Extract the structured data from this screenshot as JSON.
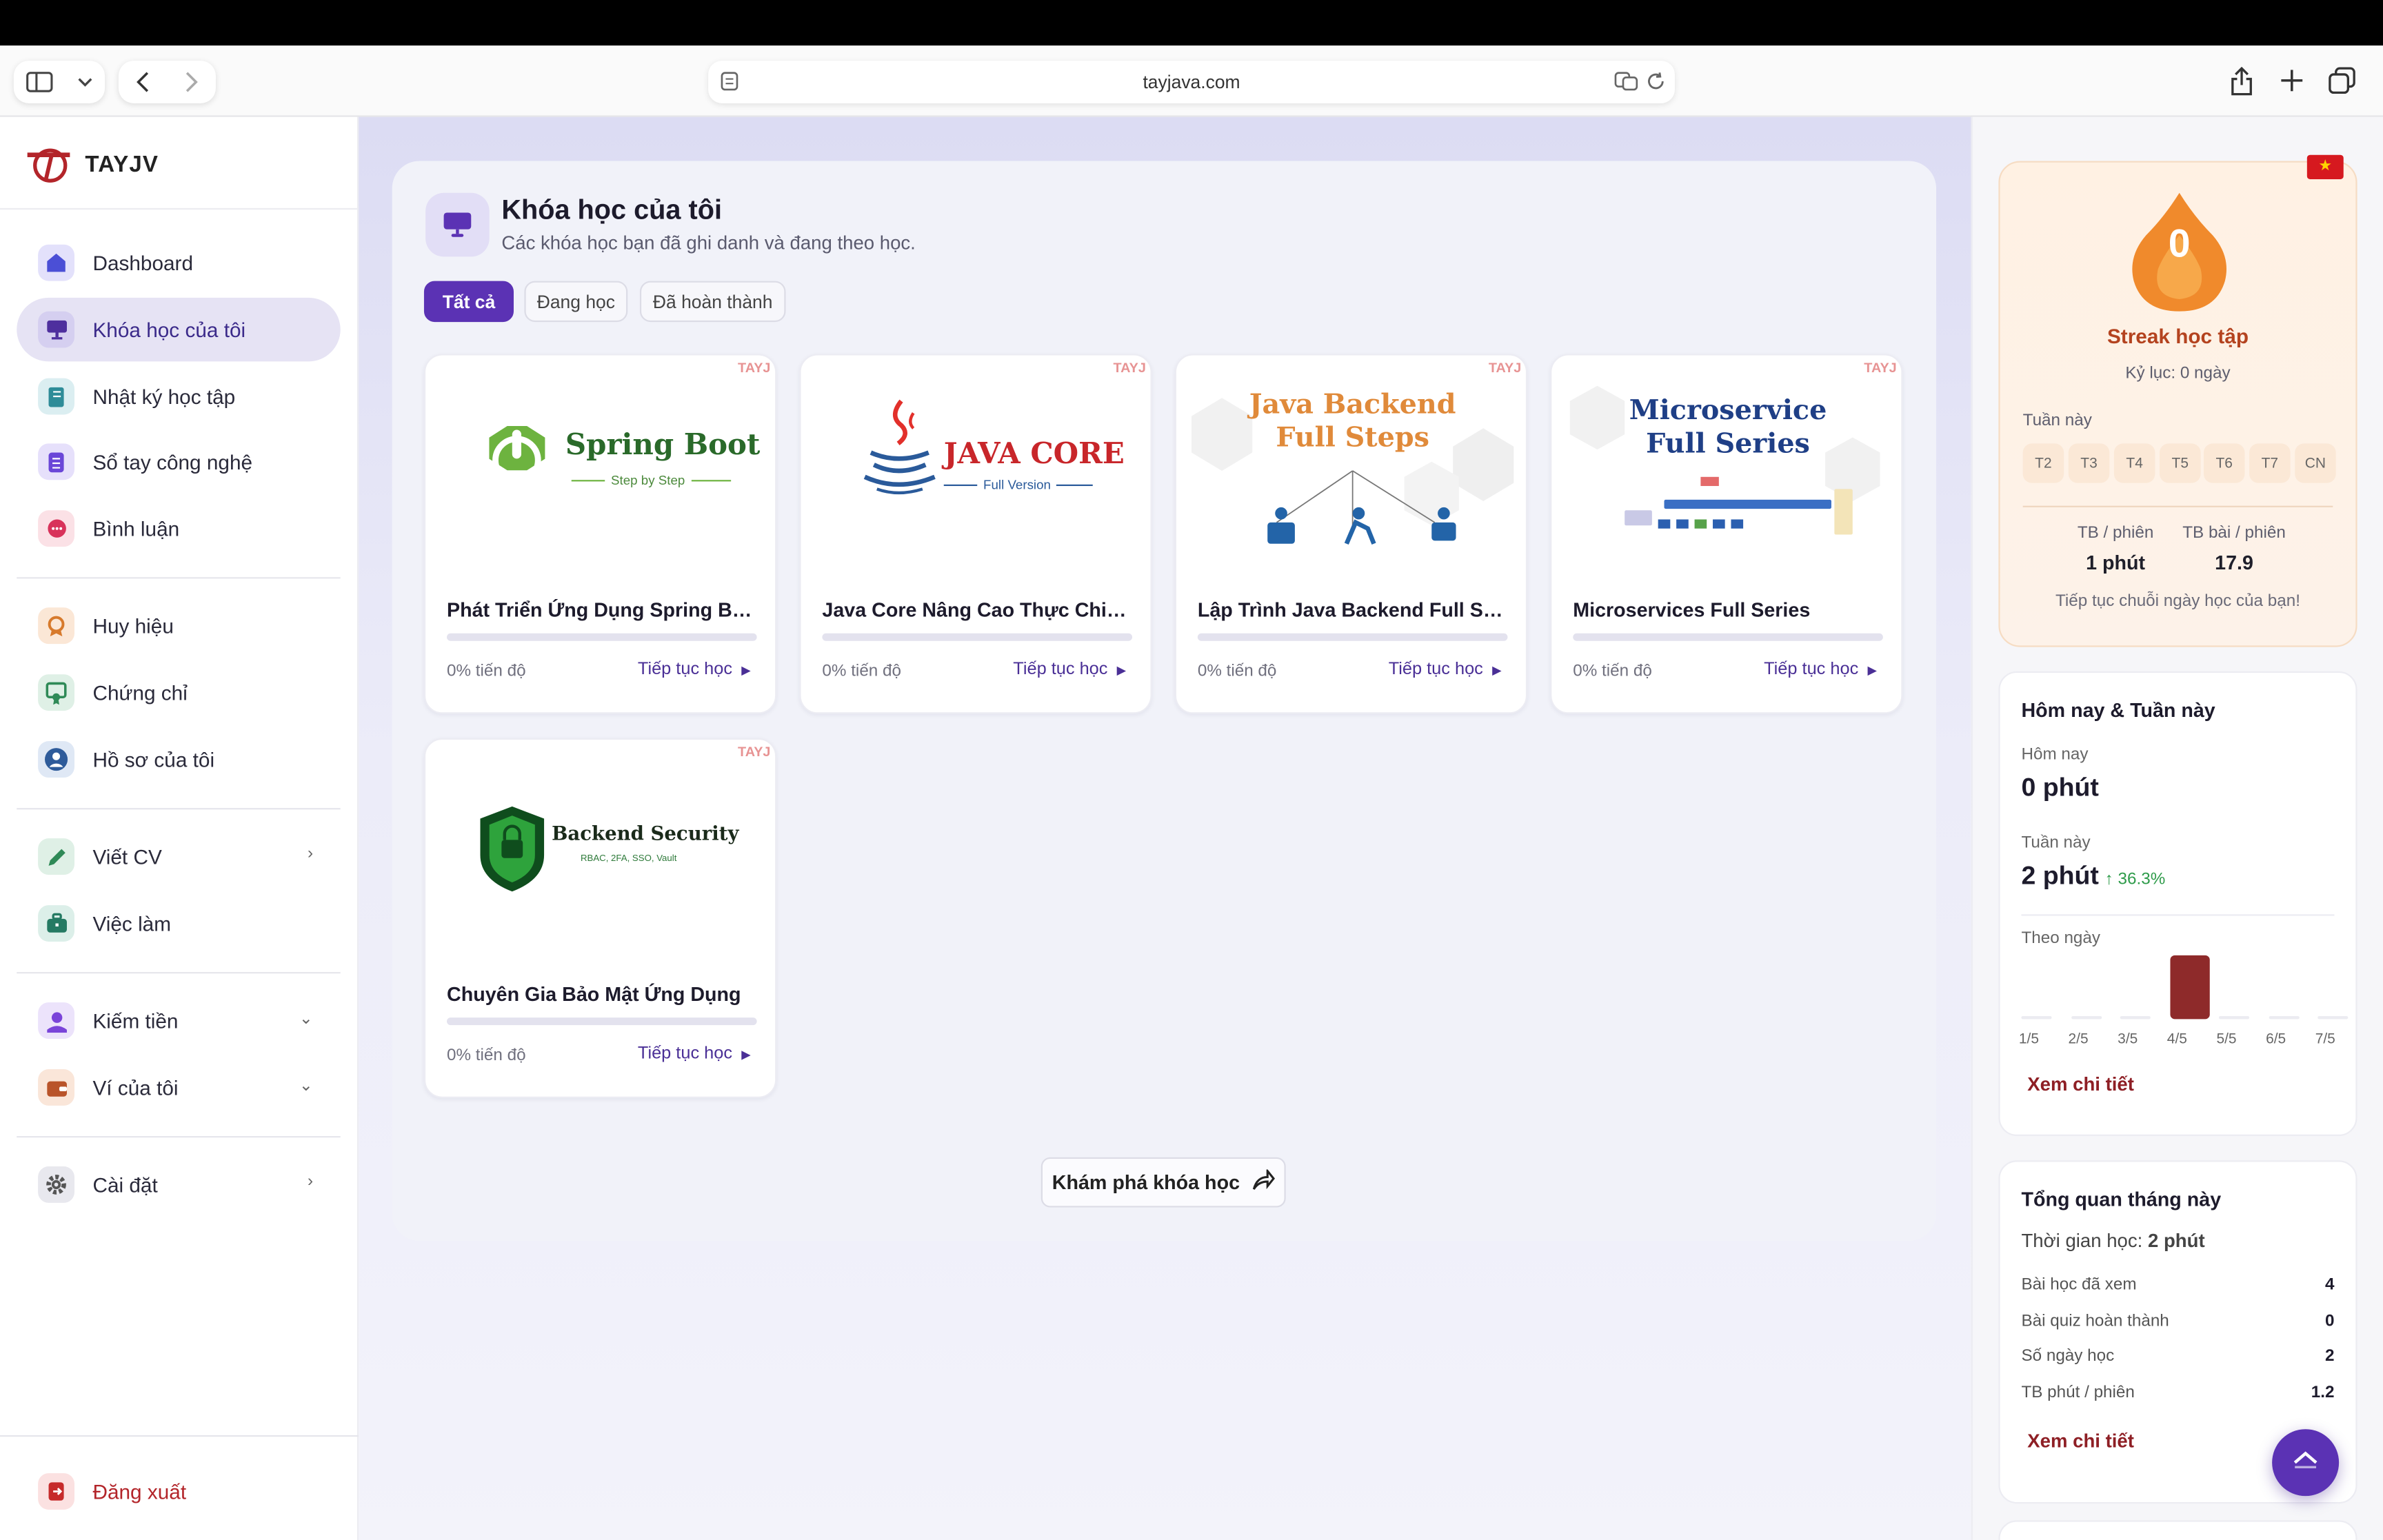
{
  "browser": {
    "url": "tayjava.com"
  },
  "sidebar": {
    "logo_text": "TAYJV",
    "items": [
      {
        "label": "Dashboard",
        "icon": "home-icon"
      },
      {
        "label": "Khóa học của tôi",
        "icon": "monitor-icon"
      },
      {
        "label": "Nhật ký học tập",
        "icon": "journal-icon"
      },
      {
        "label": "Sổ tay công nghệ",
        "icon": "notebook-icon"
      },
      {
        "label": "Bình luận",
        "icon": "comment-icon"
      },
      {
        "label": "Huy hiệu",
        "icon": "badge-icon"
      },
      {
        "label": "Chứng chỉ",
        "icon": "certificate-icon"
      },
      {
        "label": "Hồ sơ của tôi",
        "icon": "profile-icon"
      },
      {
        "label": "Viết CV",
        "icon": "pen-icon"
      },
      {
        "label": "Việc làm",
        "icon": "briefcase-icon"
      },
      {
        "label": "Kiếm tiền",
        "icon": "earn-icon"
      },
      {
        "label": "Ví của tôi",
        "icon": "wallet-icon"
      },
      {
        "label": "Cài đặt",
        "icon": "gear-icon"
      }
    ],
    "logout_label": "Đăng xuất"
  },
  "main": {
    "title": "Khóa học của tôi",
    "subtitle": "Các khóa học bạn đã ghi danh và đang theo học.",
    "filters": [
      "Tất cả",
      "Đang học",
      "Đã hoàn thành"
    ],
    "active_filter": "Tất cả",
    "watermark": "TAYJ",
    "courses": [
      {
        "title": "Phát Triển Ứng Dụng Spring Bo...",
        "progress": "0% tiến độ",
        "progress_value": 0,
        "cta": "Tiếp tục học",
        "thumb_title": "Spring Boot",
        "thumb_sub": "Step by Step"
      },
      {
        "title": "Java Core Nâng Cao Thực Chiến ...",
        "progress": "0% tiến độ",
        "progress_value": 0,
        "cta": "Tiếp tục học",
        "thumb_title": "JAVA CORE",
        "thumb_sub": "Full Version"
      },
      {
        "title": "Lập Trình Java Backend Full Steps",
        "progress": "0% tiến độ",
        "progress_value": 0,
        "cta": "Tiếp tục học",
        "thumb_title_1": "Java Backend",
        "thumb_title_2": "Full Steps"
      },
      {
        "title": "Microservices Full Series",
        "progress": "0% tiến độ",
        "progress_value": 0,
        "cta": "Tiếp tục học",
        "thumb_title_1": "Microservice",
        "thumb_title_2": "Full Series"
      },
      {
        "title": "Chuyên Gia Bảo Mật Ứng Dụng",
        "progress": "0% tiến độ",
        "progress_value": 0,
        "cta": "Tiếp tục học",
        "thumb_title": "Backend Security",
        "thumb_sub": "RBAC, 2FA, SSO, Vault"
      }
    ],
    "explore_label": "Khám phá khóa học"
  },
  "streak": {
    "count": "0",
    "title": "Streak học tập",
    "record": "Kỷ lục: 0 ngày",
    "week_label": "Tuần này",
    "days": [
      "T2",
      "T3",
      "T4",
      "T5",
      "T6",
      "T7",
      "CN"
    ],
    "avg_session_label": "TB / phiên",
    "avg_session_value": "1 phút",
    "avg_lessons_label": "TB bài / phiên",
    "avg_lessons_value": "17.9",
    "footer": "Tiếp tục chuỗi ngày học của bạn!"
  },
  "today_week": {
    "title": "Hôm nay & Tuần này",
    "today_label": "Hôm nay",
    "today_value": "0 phút",
    "week_label": "Tuần này",
    "week_value": "2 phút",
    "week_growth": "↑ 36.3%",
    "by_day_label": "Theo ngày",
    "chart_days": [
      "1/5",
      "2/5",
      "3/5",
      "4/5",
      "5/5",
      "6/5",
      "7/5"
    ],
    "chart_values": [
      0,
      0,
      0,
      2,
      0,
      0,
      0
    ],
    "link": "Xem chi tiết"
  },
  "month": {
    "title": "Tổng quan tháng này",
    "time_label": "Thời gian học:",
    "time_value": "2 phút",
    "rows": [
      {
        "label": "Bài học đã xem",
        "value": "4"
      },
      {
        "label": "Bài quiz hoàn thành",
        "value": "0"
      },
      {
        "label": "Số ngày học",
        "value": "2"
      },
      {
        "label": "TB phút / phiên",
        "value": "1.2"
      }
    ],
    "link": "Xem chi tiết"
  },
  "colors": {
    "accent": "#5b32b4",
    "streak": "#f08a2c",
    "chart_highlight": "#8e2a2a",
    "link_red": "#8e1f25"
  }
}
